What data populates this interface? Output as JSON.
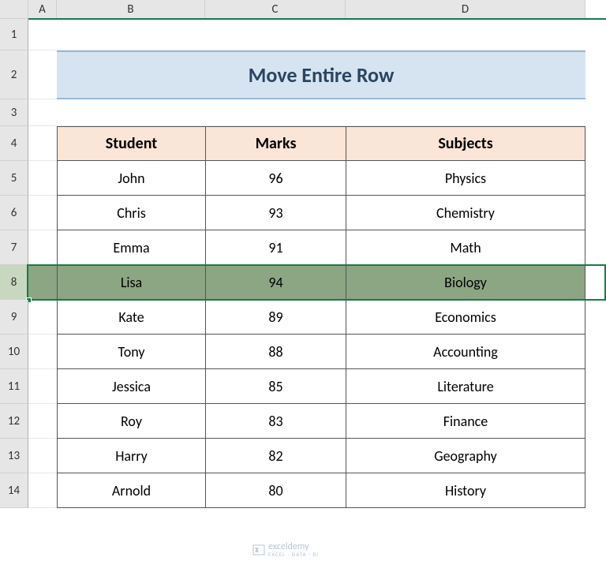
{
  "columns": [
    "A",
    "B",
    "C",
    "D"
  ],
  "row_numbers": [
    "1",
    "2",
    "3",
    "4",
    "5",
    "6",
    "7",
    "8",
    "9",
    "10",
    "11",
    "12",
    "13",
    "14"
  ],
  "title": "Move Entire Row",
  "headers": {
    "student": "Student",
    "marks": "Marks",
    "subjects": "Subjects"
  },
  "chart_data": {
    "type": "table",
    "columns": [
      "Student",
      "Marks",
      "Subjects"
    ],
    "rows": [
      {
        "student": "John",
        "marks": 96,
        "subject": "Physics"
      },
      {
        "student": "Chris",
        "marks": 93,
        "subject": "Chemistry"
      },
      {
        "student": "Emma",
        "marks": 91,
        "subject": "Math"
      },
      {
        "student": "Lisa",
        "marks": 94,
        "subject": "Biology"
      },
      {
        "student": "Kate",
        "marks": 89,
        "subject": "Economics"
      },
      {
        "student": "Tony",
        "marks": 88,
        "subject": "Accounting"
      },
      {
        "student": "Jessica",
        "marks": 85,
        "subject": "Literature"
      },
      {
        "student": "Roy",
        "marks": 83,
        "subject": "Finance"
      },
      {
        "student": "Harry",
        "marks": 82,
        "subject": "Geography"
      },
      {
        "student": "Arnold",
        "marks": 80,
        "subject": "History"
      }
    ],
    "selected_row_index": 3
  },
  "watermark": {
    "name": "exceldemy",
    "sub": "EXCEL · DATA · BI"
  }
}
